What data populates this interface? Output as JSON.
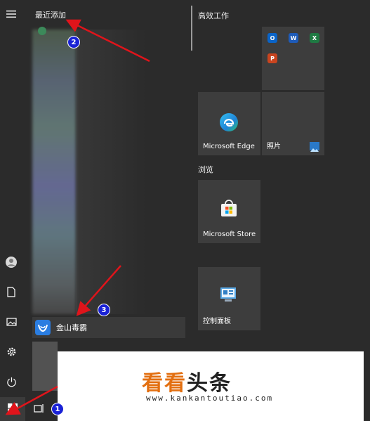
{
  "sidebar": {
    "icons": [
      "hamburger-menu-icon",
      "user-icon",
      "document-icon",
      "pictures-icon",
      "settings-icon",
      "power-icon",
      "windows-start-icon"
    ]
  },
  "app_list": {
    "recent_header": "最近添加",
    "selected_app": "金山毒霸"
  },
  "tiles": {
    "group1_title": "高效工作",
    "group2_title": "浏览",
    "edge_label": "Microsoft Edge",
    "photos_label": "照片",
    "store_label": "Microsoft Store",
    "control_panel_label": "控制面板",
    "office_mini": [
      "O",
      "W",
      "X",
      "P"
    ]
  },
  "annotations": {
    "badge_1": "1",
    "badge_2": "2",
    "badge_3": "3"
  },
  "watermark": {
    "brand_part1": "看看",
    "brand_part2": "头条",
    "url": "www.kankantoutiao.com"
  },
  "colors": {
    "background": "#2b2b2b",
    "tile": "#3d3d3d",
    "annotation_arrow": "#e0141b",
    "badge": "#1a22d6",
    "brand_orange": "#e36f10"
  }
}
